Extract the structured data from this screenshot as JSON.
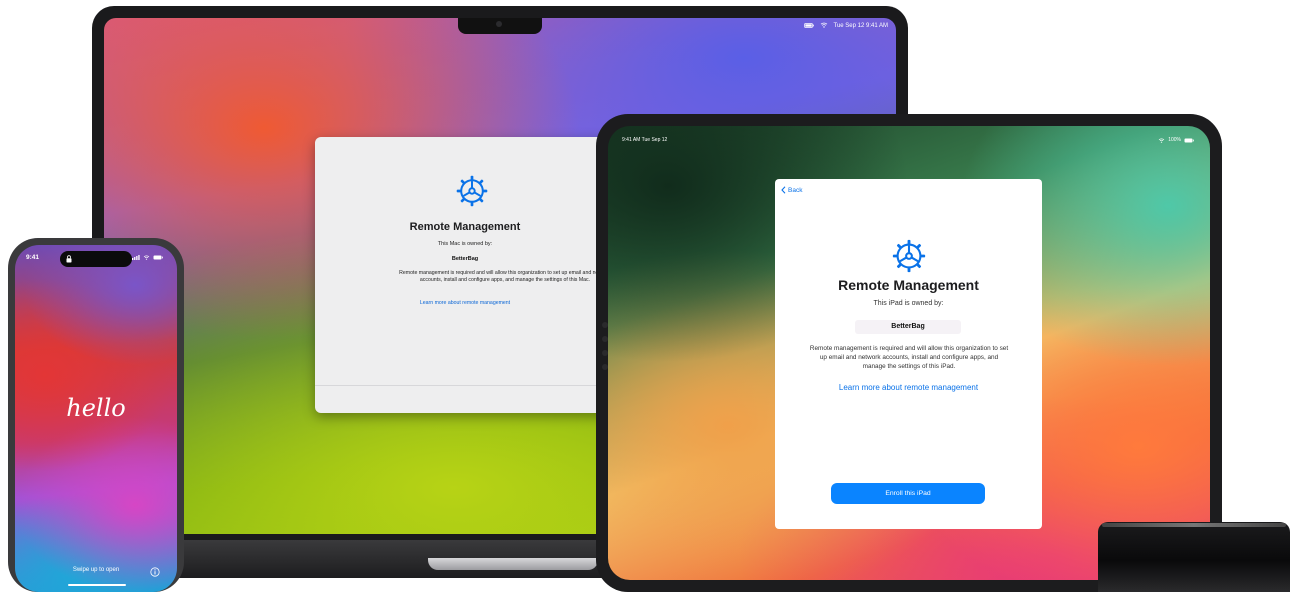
{
  "mac": {
    "menubar": {
      "date_time": "Tue Sep 12  9:41 AM",
      "icons": [
        "battery-icon",
        "wifi-icon"
      ]
    },
    "dialog": {
      "icon": "gear-icon",
      "title": "Remote Management",
      "owned_by": "This Mac is owned by:",
      "organization": "BetterBag",
      "description": "Remote management is required and will allow this organization to set up email and network accounts, install and configure apps, and manage the settings of this Mac.",
      "learn_more": "Learn more about remote management"
    }
  },
  "ipad": {
    "status": {
      "time": "9:41 AM  Tue Sep 12",
      "battery": "100%"
    },
    "dialog": {
      "back": "Back",
      "icon": "gear-icon",
      "title": "Remote Management",
      "owned_by": "This iPad is owned by:",
      "organization": "BetterBag",
      "description": "Remote management is required and will allow this organization to set up email and network accounts, install and configure apps, and manage the settings of this iPad.",
      "learn_more": "Learn more about remote management",
      "enroll_button": "Enroll this iPad"
    }
  },
  "iphone": {
    "time": "9:41",
    "greeting": "hello",
    "swipe_hint": "Swipe up to open",
    "icons": [
      "lock-icon",
      "signal-icon",
      "wifi-icon",
      "battery-icon",
      "info-icon"
    ]
  },
  "colors": {
    "accent": "#0a84ff",
    "link": "#0a72e8"
  }
}
